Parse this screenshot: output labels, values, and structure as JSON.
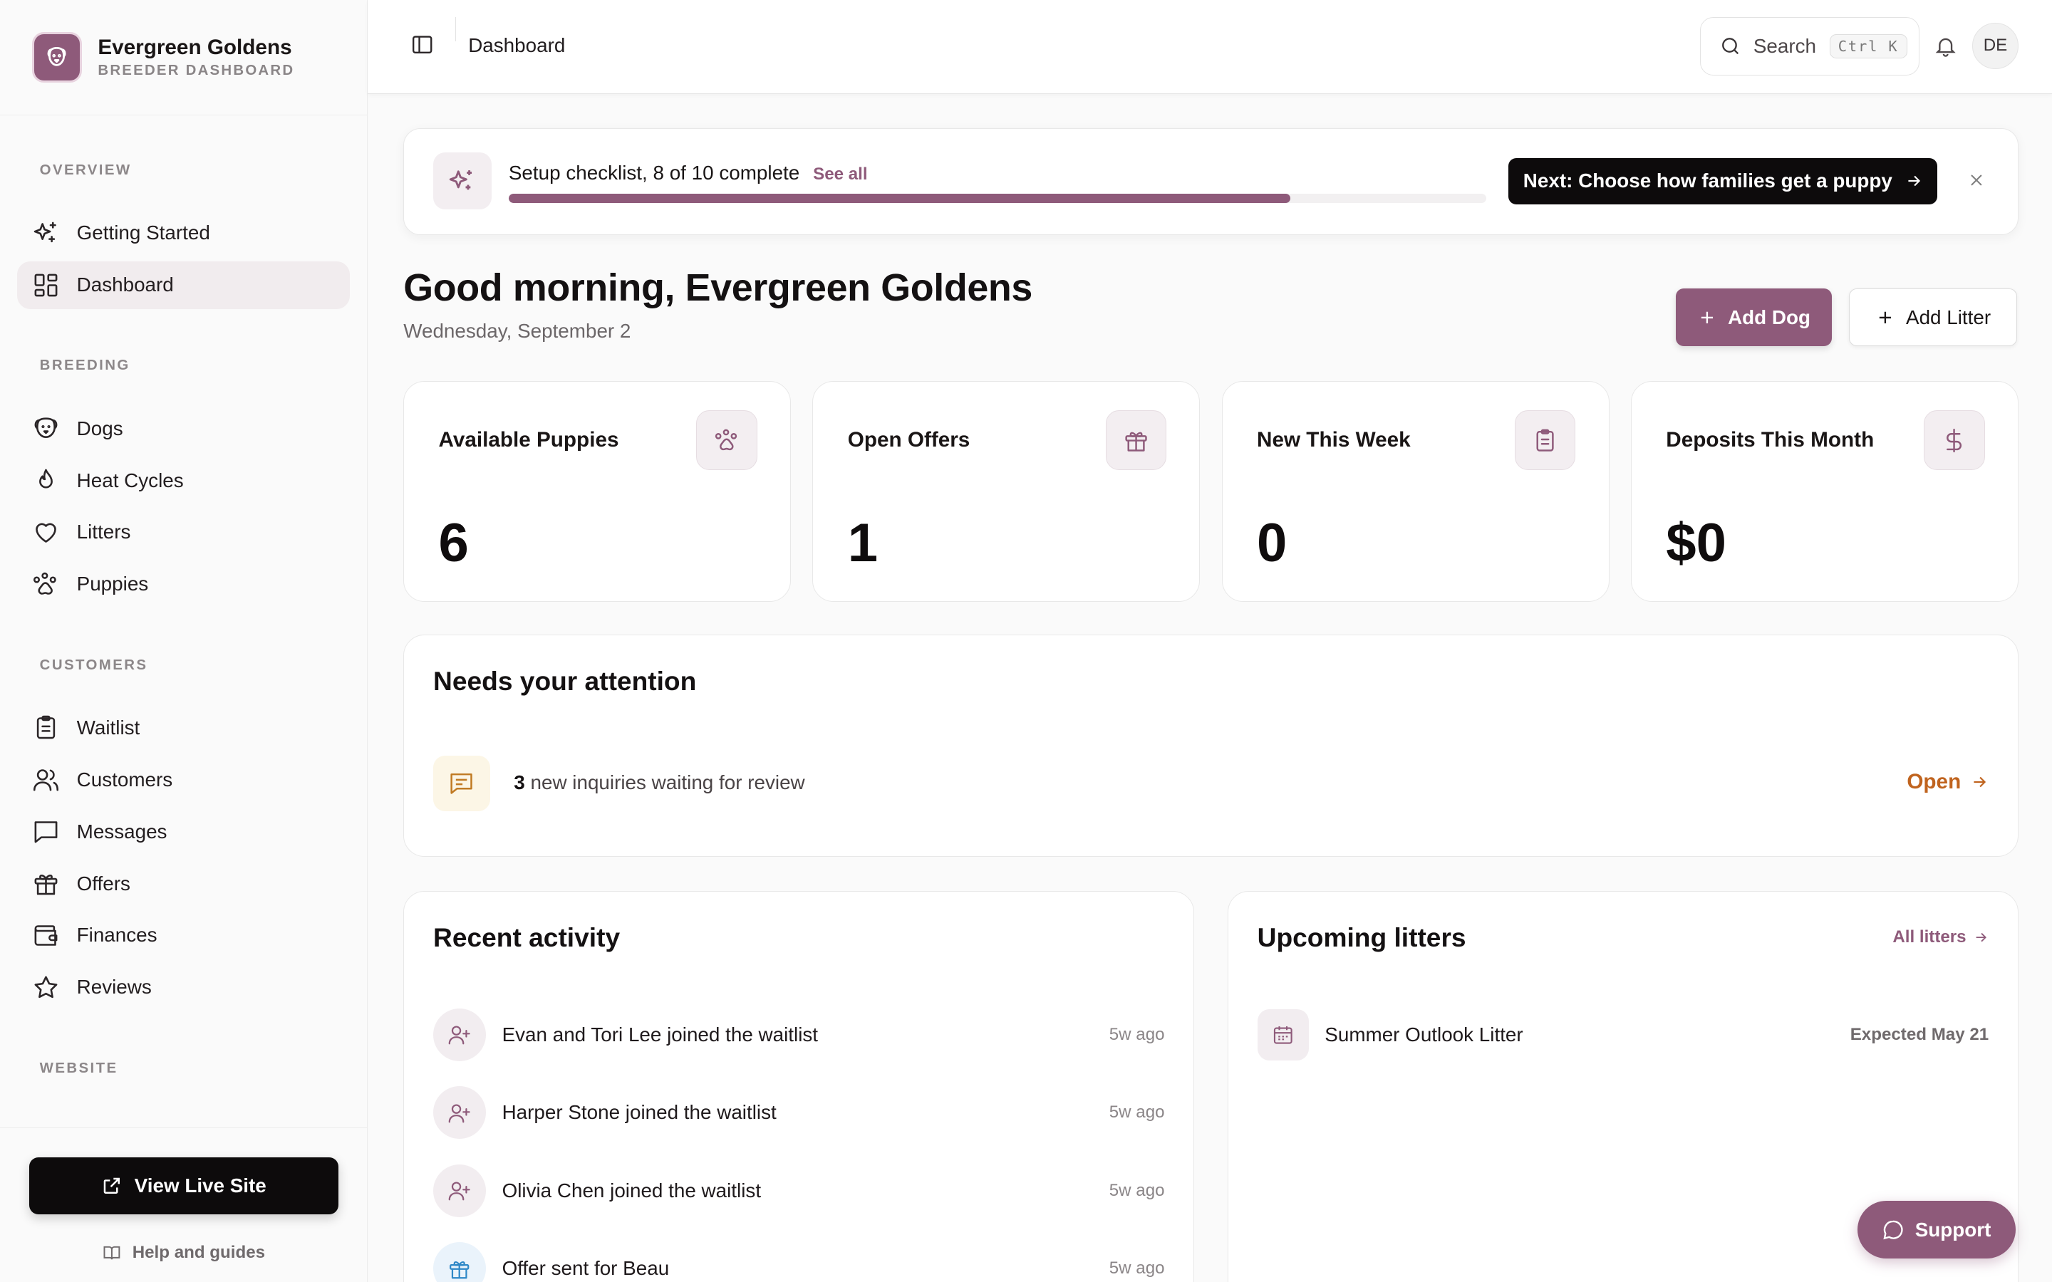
{
  "brand": {
    "name": "Evergreen Goldens",
    "subtitle": "BREEDER DASHBOARD",
    "logo_icon": "paw-icon"
  },
  "sidebar": {
    "sections": [
      {
        "label": "OVERVIEW",
        "items": [
          {
            "label": "Getting Started",
            "icon": "sparkles-icon"
          },
          {
            "label": "Dashboard",
            "icon": "grid-icon",
            "active": true
          }
        ]
      },
      {
        "label": "BREEDING",
        "items": [
          {
            "label": "Dogs",
            "icon": "dog-icon"
          },
          {
            "label": "Heat Cycles",
            "icon": "flame-icon"
          },
          {
            "label": "Litters",
            "icon": "heart-icon"
          },
          {
            "label": "Puppies",
            "icon": "paw-icon"
          }
        ]
      },
      {
        "label": "CUSTOMERS",
        "items": [
          {
            "label": "Waitlist",
            "icon": "clipboard-icon"
          },
          {
            "label": "Customers",
            "icon": "users-icon"
          },
          {
            "label": "Messages",
            "icon": "message-icon"
          },
          {
            "label": "Offers",
            "icon": "gift-icon"
          },
          {
            "label": "Finances",
            "icon": "wallet-icon"
          },
          {
            "label": "Reviews",
            "icon": "star-icon"
          }
        ]
      },
      {
        "label": "WEBSITE",
        "items": []
      }
    ],
    "live_site_label": "View Live Site",
    "help_label": "Help and guides"
  },
  "topbar": {
    "breadcrumb": "Dashboard",
    "search_label": "Search",
    "search_shortcut": "Ctrl K",
    "avatar_initials": "DE"
  },
  "checklist": {
    "title": "Setup checklist, 8 of 10 complete",
    "see_all": "See all",
    "progress_percent": 80,
    "next_label": "Next:",
    "next_action": "Choose how families get a puppy"
  },
  "greeting": {
    "title": "Good morning, Evergreen Goldens",
    "date": "Wednesday, September 2"
  },
  "actions": {
    "add_dog": "Add Dog",
    "add_litter": "Add Litter"
  },
  "stats": [
    {
      "label": "Available Puppies",
      "value": "6",
      "icon": "paw-icon"
    },
    {
      "label": "Open Offers",
      "value": "1",
      "icon": "gift-icon"
    },
    {
      "label": "New This Week",
      "value": "0",
      "icon": "clipboard-icon"
    },
    {
      "label": "Deposits This Month",
      "value": "$0",
      "icon": "dollar-icon"
    }
  ],
  "attention": {
    "title": "Needs your attention",
    "count": "3",
    "text": "new inquiries waiting for review",
    "open_label": "Open"
  },
  "recent_activity": {
    "title": "Recent activity",
    "items": [
      {
        "text": "Evan and Tori Lee joined the waitlist",
        "time": "5w ago",
        "icon": "user-plus-icon"
      },
      {
        "text": "Harper Stone joined the waitlist",
        "time": "5w ago",
        "icon": "user-plus-icon"
      },
      {
        "text": "Olivia Chen joined the waitlist",
        "time": "5w ago",
        "icon": "user-plus-icon"
      },
      {
        "text": "Offer sent for Beau",
        "time": "5w ago",
        "icon": "gift-icon"
      }
    ]
  },
  "upcoming_litters": {
    "title": "Upcoming litters",
    "all_label": "All litters",
    "items": [
      {
        "name": "Summer Outlook Litter",
        "expected": "Expected May 21"
      }
    ]
  },
  "support_label": "Support",
  "colors": {
    "accent": "#8e5a7a",
    "warning": "#c0641f",
    "info": "#2f88c7"
  }
}
